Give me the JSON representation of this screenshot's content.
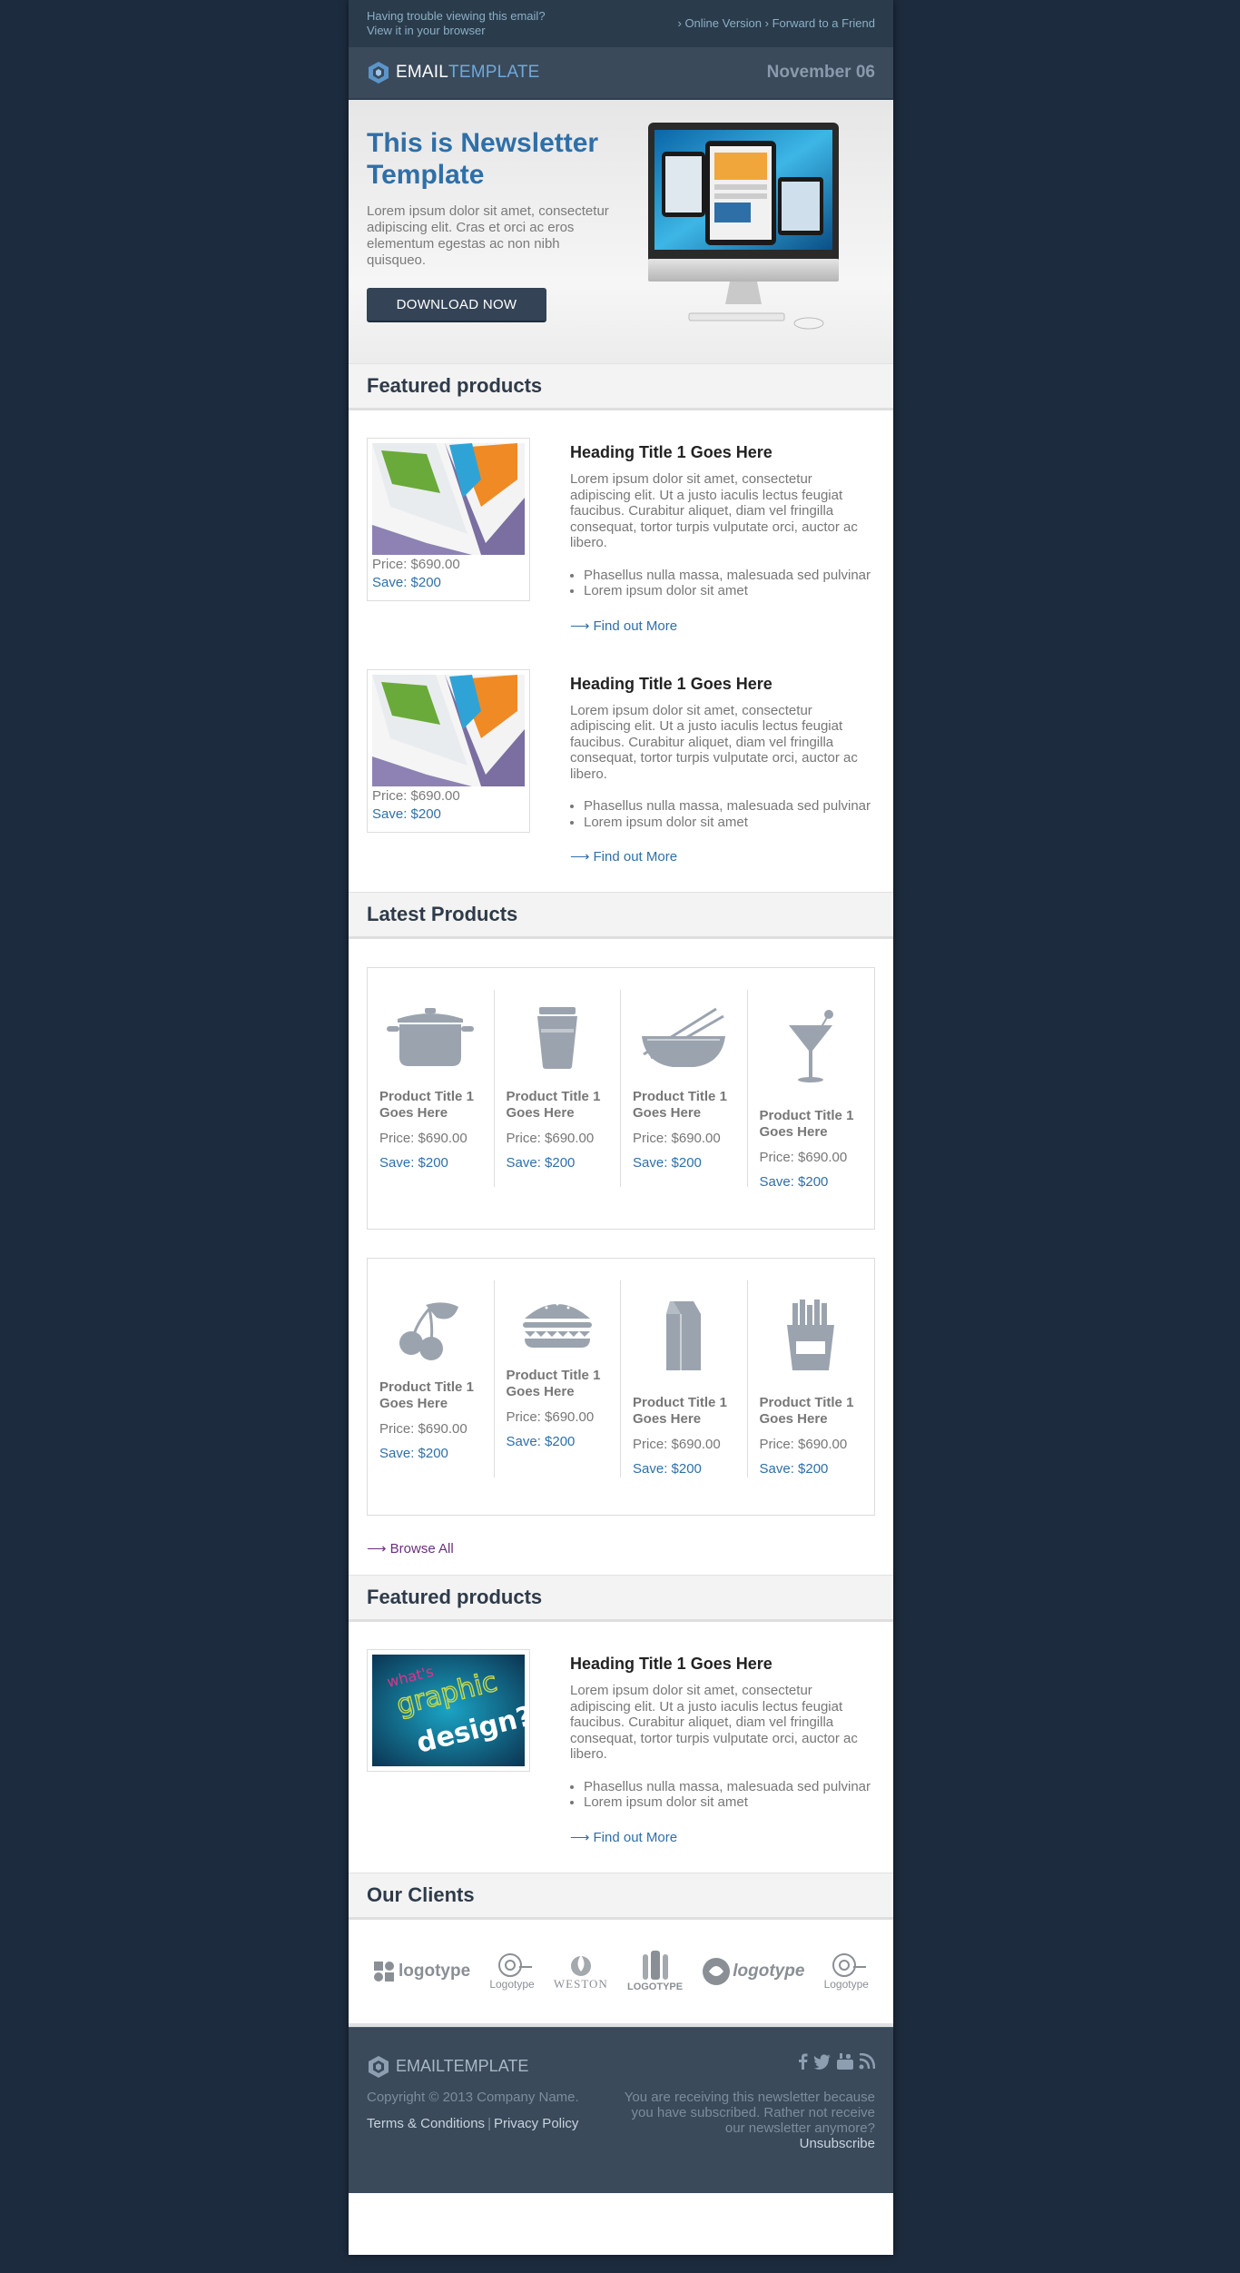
{
  "topbar": {
    "trouble_text": "Having trouble viewing this email?",
    "view_browser": "View it in your browser",
    "online_version": "› Online Version",
    "forward": "› Forward to a Friend"
  },
  "header": {
    "logo_bold": "EMAIL",
    "logo_light": "TEMPLATE",
    "date": "November 06"
  },
  "hero": {
    "title": "This is Newsletter Template",
    "text": "Lorem ipsum dolor sit amet, consectetur adipiscing elit. Cras et orci ac eros elementum egestas ac non nibh quisqueo.",
    "button": "DOWNLOAD NOW"
  },
  "featured1": {
    "title": "Featured products",
    "items": [
      {
        "heading": "Heading Title 1 Goes Here",
        "text": "Lorem ipsum dolor sit amet, consectetur adipiscing elit. Ut a justo iaculis lectus feugiat faucibus. Curabitur aliquet, diam vel fringilla consequat, tortor turpis vulputate orci, auctor ac libero.",
        "bullet1": "Phasellus nulla massa, malesuada sed pulvinar",
        "bullet2": "Lorem ipsum dolor sit amet",
        "link": "Find out More",
        "price": "Price: $690.00",
        "save": "Save: $200"
      },
      {
        "heading": "Heading Title 1 Goes Here",
        "text": "Lorem ipsum dolor sit amet, consectetur adipiscing elit. Ut a justo iaculis lectus feugiat faucibus. Curabitur aliquet, diam vel fringilla consequat, tortor turpis vulputate orci, auctor ac libero.",
        "bullet1": "Phasellus nulla massa, malesuada sed pulvinar",
        "bullet2": "Lorem ipsum dolor sit amet",
        "link": "Find out More",
        "price": "Price: $690.00",
        "save": "Save: $200"
      }
    ]
  },
  "latest": {
    "title": "Latest Products",
    "row1": [
      {
        "icon": "pot-icon",
        "title": "Product Title 1 Goes Here",
        "price": "Price: $690.00",
        "save": "Save: $200"
      },
      {
        "icon": "cup-icon",
        "title": "Product Title 1 Goes Here",
        "price": "Price: $690.00",
        "save": "Save: $200"
      },
      {
        "icon": "bowl-chopsticks-icon",
        "title": "Product Title 1 Goes Here",
        "price": "Price: $690.00",
        "save": "Save: $200"
      },
      {
        "icon": "cocktail-icon",
        "title": "Product Title 1 Goes Here",
        "price": "Price: $690.00",
        "save": "Save: $200"
      }
    ],
    "row2": [
      {
        "icon": "cherry-icon",
        "title": "Product Title 1 Goes Here",
        "price": "Price: $690.00",
        "save": "Save: $200"
      },
      {
        "icon": "burger-icon",
        "title": "Product Title 1 Goes Here",
        "price": "Price: $690.00",
        "save": "Save: $200"
      },
      {
        "icon": "milk-carton-icon",
        "title": "Product Title 1 Goes Here",
        "price": "Price: $690.00",
        "save": "Save: $200"
      },
      {
        "icon": "fries-icon",
        "title": "Product Title 1 Goes Here",
        "price": "Price: $690.00",
        "save": "Save: $200"
      }
    ],
    "browse": "Browse All"
  },
  "featured2": {
    "title": "Featured products",
    "image_text_1": "what's",
    "image_text_2": "graphic",
    "image_text_3": "design?",
    "heading": "Heading Title 1 Goes Here",
    "text": "Lorem ipsum dolor sit amet, consectetur adipiscing elit. Ut a justo iaculis lectus feugiat faucibus. Curabitur aliquet, diam vel fringilla consequat, tortor turpis vulputate orci, auctor ac libero.",
    "bullet1": "Phasellus nulla massa, malesuada sed pulvinar",
    "bullet2": "Lorem ipsum dolor sit amet",
    "link": "Find out More"
  },
  "clients": {
    "title": "Our Clients",
    "logos": [
      "logotype",
      "Logotype",
      "WESTON",
      "LOGOTYPE",
      "logotype",
      "Logotype"
    ]
  },
  "footer": {
    "logo": "EMAILTEMPLATE",
    "copyright": "Copyright © 2013 Company Name.",
    "terms": "Terms & Conditions",
    "privacy": "Privacy Policy",
    "notice": "You are receiving this newsletter because you have subscribed. Rather not receive our newsletter anymore?",
    "unsubscribe": "Unsubscribe"
  },
  "colors": {
    "background": "#1c2b3e",
    "accent": "#2f6fa7",
    "header": "#3a4a5b",
    "button": "#344456"
  }
}
